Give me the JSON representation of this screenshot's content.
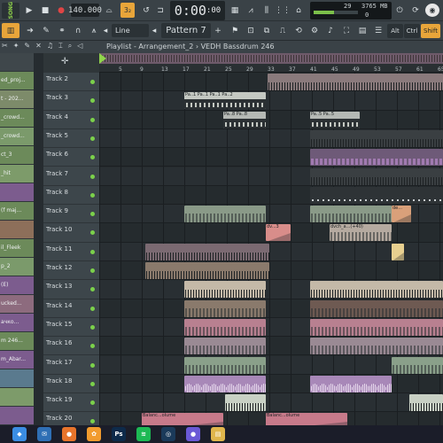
{
  "toolbar": {
    "mode": "SONG",
    "tempo": "140.000",
    "time_main": "0:00",
    "time_sub": ":00",
    "pattern": "Pattern 7",
    "snap": "Line",
    "monitor_value": "29",
    "monitor_mem": "3765 MB",
    "monitor_sub": "0",
    "keys": [
      "Alt",
      "Ctrl",
      "Shift"
    ]
  },
  "playlist": {
    "title": "Playlist - Arrangement_2 › VEDH Bassdrum 246"
  },
  "ruler": [
    "5",
    "9",
    "13",
    "17",
    "21",
    "25",
    "29",
    "33",
    "37",
    "41",
    "45",
    "49",
    "53",
    "57",
    "61",
    "65"
  ],
  "browser": [
    {
      "label": "",
      "color": "#3f474b"
    },
    {
      "label": "ed_proj...",
      "color": "#6c8a5a"
    },
    {
      "label": "t - 202...",
      "color": "#7d8b6a"
    },
    {
      "label": "_crowd...",
      "color": "#6c8a5a"
    },
    {
      "label": "_crowd...",
      "color": "#7b9a6b"
    },
    {
      "label": "ct_3",
      "color": "#6c8a5a"
    },
    {
      "label": "_hit",
      "color": "#7d9b6a"
    },
    {
      "label": "",
      "color": "#7c5c8e"
    },
    {
      "label": "(f maj...",
      "color": "#6c8a5a"
    },
    {
      "label": "",
      "color": "#8d6f5a"
    },
    {
      "label": "il_Fleek",
      "color": "#6c8a5a"
    },
    {
      "label": "p_2",
      "color": "#7b9a6b"
    },
    {
      "label": "(E)",
      "color": "#7c5c8e"
    },
    {
      "label": "ucked...",
      "color": "#8d6b7e"
    },
    {
      "label": "ачко...",
      "color": "#7c5c8e"
    },
    {
      "label": "m 246...",
      "color": "#6c8a5a"
    },
    {
      "label": "m_Abar...",
      "color": "#7c5c8e"
    },
    {
      "label": "",
      "color": "#5a7a8e"
    },
    {
      "label": "",
      "color": "#7d9b6a"
    },
    {
      "label": "",
      "color": "#7c5c8e"
    }
  ],
  "tracks": [
    "Track 2",
    "Track 3",
    "Track 4",
    "Track 5",
    "Track 6",
    "Track 7",
    "Track 8",
    "Track 9",
    "Track 10",
    "Track 11",
    "Track 12",
    "Track 13",
    "Track 14",
    "Track 15",
    "Track 16",
    "Track 17",
    "Track 18",
    "Track 19",
    "Track 20"
  ],
  "clips": [
    {
      "row": 0,
      "start": 190,
      "width": 198,
      "color": "#8a7a7c",
      "pattern": "ticks"
    },
    {
      "row": 1,
      "start": 96,
      "width": 92,
      "color": "#c4c8c2",
      "label": "Pa..1 Pa..1 Pa..1 Pa..2",
      "pattern": "dark"
    },
    {
      "row": 2,
      "start": 140,
      "width": 48,
      "color": "#b5b9b5",
      "label": "Pa..8 Pa..8",
      "pattern": "dark"
    },
    {
      "row": 2,
      "start": 238,
      "width": 56,
      "color": "#b5b9b5",
      "label": "Pa..5 Pa..5",
      "pattern": "dark"
    },
    {
      "row": 3,
      "start": 238,
      "width": 150,
      "color": "#3a3f42",
      "pattern": "ticks"
    },
    {
      "row": 4,
      "start": 238,
      "width": 150,
      "color": "#6e5a78",
      "pattern": "purple"
    },
    {
      "row": 5,
      "start": 238,
      "width": 150,
      "color": "#3a3f42",
      "pattern": "ticks"
    },
    {
      "row": 6,
      "start": 238,
      "width": 150,
      "color": "#2e3336",
      "pattern": "dots"
    },
    {
      "row": 7,
      "start": 96,
      "width": 92,
      "color": "#8a9a88",
      "pattern": "stripes"
    },
    {
      "row": 7,
      "start": 238,
      "width": 92,
      "color": "#8a9a88",
      "pattern": "stripes"
    },
    {
      "row": 7,
      "start": 330,
      "width": 22,
      "color": "#d9a07a",
      "label": "de...",
      "pattern": "ramp"
    },
    {
      "row": 8,
      "start": 188,
      "width": 28,
      "color": "#d88d8a",
      "label": "dv...3",
      "pattern": "ramp"
    },
    {
      "row": 8,
      "start": 260,
      "width": 70,
      "color": "#b5aaa0",
      "label": "dvch_a...(+40)",
      "pattern": "stripes"
    },
    {
      "row": 9,
      "start": 52,
      "width": 140,
      "color": "#7b6a72",
      "pattern": "ticks"
    },
    {
      "row": 9,
      "start": 330,
      "width": 14,
      "color": "#e8d090",
      "pattern": "ramp"
    },
    {
      "row": 10,
      "start": 52,
      "width": 140,
      "color": "#8a7a6c",
      "pattern": "ticks"
    },
    {
      "row": 11,
      "start": 96,
      "width": 92,
      "color": "#c4b9a8",
      "pattern": "ticks"
    },
    {
      "row": 11,
      "start": 238,
      "width": 150,
      "color": "#c4b9a8",
      "pattern": "ticks"
    },
    {
      "row": 12,
      "start": 96,
      "width": 92,
      "color": "#8a7a6c",
      "pattern": "stripes"
    },
    {
      "row": 12,
      "start": 238,
      "width": 150,
      "color": "#6e5a52",
      "pattern": "stripes"
    },
    {
      "row": 13,
      "start": 96,
      "width": 92,
      "color": "#b88090",
      "pattern": "stripes"
    },
    {
      "row": 13,
      "start": 238,
      "width": 150,
      "color": "#b88090",
      "pattern": "stripes"
    },
    {
      "row": 14,
      "start": 96,
      "width": 92,
      "color": "#9a8a94",
      "pattern": "stripes"
    },
    {
      "row": 14,
      "start": 238,
      "width": 150,
      "color": "#9a8a94",
      "pattern": "stripes"
    },
    {
      "row": 15,
      "start": 96,
      "width": 92,
      "color": "#8aa08a",
      "pattern": "stripes"
    },
    {
      "row": 15,
      "start": 330,
      "width": 58,
      "color": "#8aa08a",
      "pattern": "stripes"
    },
    {
      "row": 16,
      "start": 96,
      "width": 92,
      "color": "#a888b8",
      "pattern": "wave"
    },
    {
      "row": 16,
      "start": 238,
      "width": 92,
      "color": "#a888b8",
      "pattern": "wave"
    },
    {
      "row": 17,
      "start": 142,
      "width": 46,
      "color": "#c8d0c4",
      "pattern": "ticks"
    },
    {
      "row": 17,
      "start": 350,
      "width": 38,
      "color": "#c8d0c4",
      "pattern": "ticks"
    },
    {
      "row": 18,
      "start": 48,
      "width": 92,
      "color": "#c77a8a",
      "label": "Balanc...olume",
      "pattern": "ramp"
    },
    {
      "row": 18,
      "start": 188,
      "width": 92,
      "color": "#c77a8a",
      "label": "Balanc...olume",
      "pattern": "ramp"
    }
  ],
  "taskbar": [
    {
      "name": "windows-icon",
      "glyph": "◆",
      "color": "#3b8de3"
    },
    {
      "name": "mail-icon",
      "glyph": "✉",
      "color": "#2f6fb5"
    },
    {
      "name": "firefox-icon",
      "glyph": "●",
      "color": "#e8742b"
    },
    {
      "name": "fl-studio-icon",
      "glyph": "✿",
      "color": "#f29b2e"
    },
    {
      "name": "ps-icon",
      "glyph": "Ps",
      "color": "#0d2a4a"
    },
    {
      "name": "spotify-icon",
      "glyph": "≋",
      "color": "#1db954"
    },
    {
      "name": "steam-icon",
      "glyph": "◎",
      "color": "#1b3a5a"
    },
    {
      "name": "app-icon",
      "glyph": "●",
      "color": "#6a59d6"
    },
    {
      "name": "explorer-icon",
      "glyph": "▤",
      "color": "#e0b64c"
    }
  ]
}
